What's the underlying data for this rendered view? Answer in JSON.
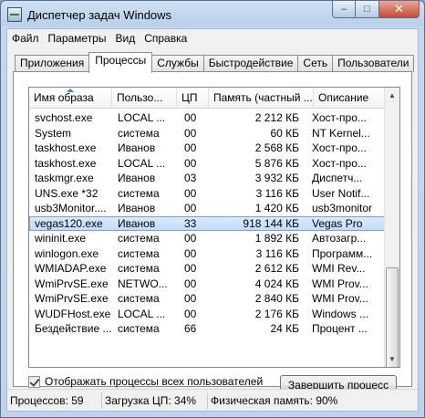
{
  "window": {
    "title": "Диспетчер задач Windows",
    "controls": {
      "minimize": "–",
      "maximize": "□",
      "close": "✕"
    }
  },
  "menu": [
    "Файл",
    "Параметры",
    "Вид",
    "Справка"
  ],
  "tabs": [
    {
      "label": "Приложения",
      "active": false
    },
    {
      "label": "Процессы",
      "active": true
    },
    {
      "label": "Службы",
      "active": false
    },
    {
      "label": "Быстродействие",
      "active": false
    },
    {
      "label": "Сеть",
      "active": false
    },
    {
      "label": "Пользователи",
      "active": false
    }
  ],
  "table": {
    "columns": [
      "Имя образа",
      "Пользо...",
      "ЦП",
      "Память (частный ...",
      "Описание"
    ],
    "sorted_column": "Имя образа",
    "selected_row": "vegas120.exe",
    "rows": [
      [
        "svchost.exe",
        "LOCAL ...",
        "00",
        "2 212 КБ",
        "Хост-про..."
      ],
      [
        "System",
        "система",
        "00",
        "60 КБ",
        "NT Kernel..."
      ],
      [
        "taskhost.exe",
        "Иванов",
        "00",
        "2 568 КБ",
        "Хост-про..."
      ],
      [
        "taskhost.exe",
        "LOCAL ...",
        "00",
        "5 876 КБ",
        "Хост-про..."
      ],
      [
        "taskmgr.exe",
        "Иванов",
        "03",
        "3 932 КБ",
        "Диспетч..."
      ],
      [
        "UNS.exe *32",
        "система",
        "00",
        "3 116 КБ",
        "User Notif..."
      ],
      [
        "usb3Monitor....",
        "Иванов",
        "00",
        "1 420 КБ",
        "usb3monitor"
      ],
      [
        "vegas120.exe",
        "Иванов",
        "33",
        "918 144 КБ",
        "Vegas Pro"
      ],
      [
        "wininit.exe",
        "система",
        "00",
        "1 892 КБ",
        "Автозагр..."
      ],
      [
        "winlogon.exe",
        "система",
        "00",
        "3 116 КБ",
        "Программ..."
      ],
      [
        "WMIADAP.exe",
        "система",
        "00",
        "2 612 КБ",
        "WMI Rev..."
      ],
      [
        "WmiPrvSE.exe",
        "NETWO...",
        "00",
        "4 024 КБ",
        "WMI Prov..."
      ],
      [
        "WmiPrvSE.exe",
        "система",
        "00",
        "2 840 КБ",
        "WMI Prov..."
      ],
      [
        "WUDFHost.exe",
        "LOCAL ...",
        "00",
        "2 176 КБ",
        "Windows ..."
      ],
      [
        "Бездействие ...",
        "система",
        "66",
        "24 КБ",
        "Процент ..."
      ]
    ]
  },
  "show_all_users": {
    "label": "Отображать процессы всех пользователей",
    "checked": true
  },
  "end_process_button": "Завершить процесс",
  "status": {
    "processes": "Процессов: 59",
    "cpu": "Загрузка ЦП: 34%",
    "memory": "Физическая память: 90%"
  },
  "icons": {
    "scroll_up": "▲",
    "scroll_down": "▼"
  }
}
